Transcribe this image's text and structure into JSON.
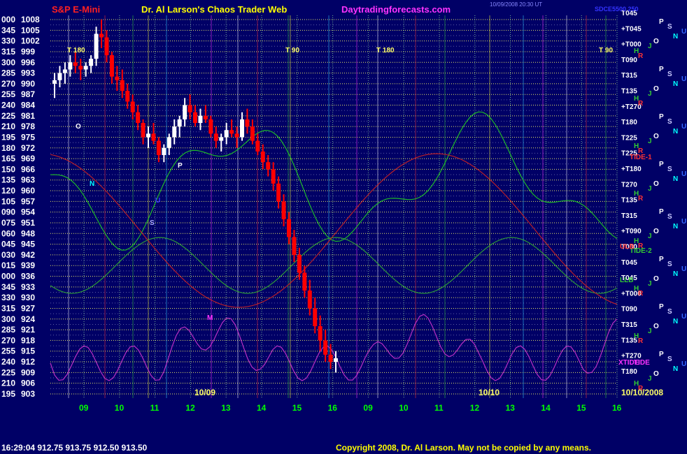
{
  "header": {
    "title_left": "S&P E-Mini",
    "title_center": "Dr. Al Larson's Chaos Trader Web",
    "title_right": "Daytradingforecasts.com",
    "timestamp": "10/09/2008 20:30 UT",
    "tag_right": "SDCE5500 250"
  },
  "footer": {
    "quote": "16:29:04  912.75 913.75 912.50 913.50",
    "copyright": "Copyright 2008, Dr. Al Larson. May not be copied by any means."
  },
  "chart_data": {
    "type": "candlestick",
    "ylim": [
      903,
      1008
    ],
    "y_ticks": [
      {
        "angle": "000",
        "price": "1008"
      },
      {
        "angle": "345",
        "price": "1005"
      },
      {
        "angle": "330",
        "price": "1002"
      },
      {
        "angle": "315",
        "price": "999"
      },
      {
        "angle": "300",
        "price": "996"
      },
      {
        "angle": "285",
        "price": "993"
      },
      {
        "angle": "270",
        "price": "990"
      },
      {
        "angle": "255",
        "price": "987"
      },
      {
        "angle": "240",
        "price": "984"
      },
      {
        "angle": "225",
        "price": "981"
      },
      {
        "angle": "210",
        "price": "978"
      },
      {
        "angle": "195",
        "price": "975"
      },
      {
        "angle": "180",
        "price": "972"
      },
      {
        "angle": "165",
        "price": "969"
      },
      {
        "angle": "150",
        "price": "966"
      },
      {
        "angle": "135",
        "price": "963"
      },
      {
        "angle": "120",
        "price": "960"
      },
      {
        "angle": "105",
        "price": "957"
      },
      {
        "angle": "090",
        "price": "954"
      },
      {
        "angle": "075",
        "price": "951"
      },
      {
        "angle": "060",
        "price": "948"
      },
      {
        "angle": "045",
        "price": "945"
      },
      {
        "angle": "030",
        "price": "942"
      },
      {
        "angle": "015",
        "price": "939"
      },
      {
        "angle": "000",
        "price": "936"
      },
      {
        "angle": "345",
        "price": "933"
      },
      {
        "angle": "330",
        "price": "930"
      },
      {
        "angle": "315",
        "price": "927"
      },
      {
        "angle": "300",
        "price": "924"
      },
      {
        "angle": "285",
        "price": "921"
      },
      {
        "angle": "270",
        "price": "918"
      },
      {
        "angle": "255",
        "price": "915"
      },
      {
        "angle": "240",
        "price": "912"
      },
      {
        "angle": "225",
        "price": "909"
      },
      {
        "angle": "210",
        "price": "906"
      },
      {
        "angle": "195",
        "price": "903"
      }
    ],
    "x_ticks": [
      "09",
      "10",
      "11",
      "12",
      "13",
      "14",
      "15",
      "16",
      "09",
      "10",
      "11",
      "12",
      "13",
      "14",
      "15",
      "16"
    ],
    "date_labels": [
      "10/09",
      "10/10",
      "10/10/2008"
    ],
    "right_labels": [
      "T045",
      "+T045",
      "+T000",
      "T090",
      "T315",
      "T135",
      "+T270",
      "T180",
      "T225",
      "T225",
      "+T180",
      "T270",
      "T135",
      "T315",
      "+T090",
      "T000",
      "T045",
      "T045",
      "+T000",
      "T090",
      "T315",
      "T135",
      "+T270",
      "T180"
    ],
    "right_letters": [
      "P",
      "S",
      "U",
      "N",
      "O",
      "J",
      "H",
      "R"
    ],
    "annotations": [
      "T 180",
      "T 90",
      "T 180",
      "T 90",
      "O",
      "P",
      "M",
      "S",
      "U",
      "N",
      "TIDE-1",
      "TIDE-2",
      "ULB",
      "LLB",
      "XTIDE",
      "TIDE"
    ],
    "colors": {
      "background": "#000066",
      "price_labels": "#FFFFFF",
      "time_labels": "#00FF00",
      "title_left": "#FF2020",
      "title_center": "#FFFF00",
      "title_right": "#FF33FF",
      "up_bar": "#FFFFFF",
      "down_bar": "#FF0000",
      "gridline": "#FFFF66",
      "flux_green": "#22CC22",
      "flux_magenta": "#CC33CC",
      "flux_red": "#CC2222"
    },
    "ohlc": [
      [
        990,
        993,
        986,
        991
      ],
      [
        991,
        995,
        989,
        993
      ],
      [
        993,
        996,
        990,
        994
      ],
      [
        994,
        998,
        992,
        996
      ],
      [
        996,
        999,
        993,
        995
      ],
      [
        995,
        997,
        991,
        994
      ],
      [
        994,
        996,
        992,
        995
      ],
      [
        995,
        998,
        993,
        997
      ],
      [
        997,
        1006,
        995,
        1004
      ],
      [
        1004,
        1008,
        1000,
        1003
      ],
      [
        1003,
        1005,
        996,
        998
      ],
      [
        998,
        999,
        990,
        992
      ],
      [
        992,
        995,
        988,
        991
      ],
      [
        991,
        994,
        986,
        988
      ],
      [
        988,
        990,
        983,
        985
      ],
      [
        985,
        987,
        980,
        982
      ],
      [
        982,
        984,
        977,
        979
      ],
      [
        979,
        980,
        973,
        975
      ],
      [
        975,
        978,
        972,
        976
      ],
      [
        976,
        979,
        973,
        974
      ],
      [
        974,
        975,
        968,
        970
      ],
      [
        970,
        973,
        968,
        972
      ],
      [
        972,
        976,
        970,
        975
      ],
      [
        975,
        980,
        973,
        978
      ],
      [
        978,
        981,
        975,
        980
      ],
      [
        980,
        986,
        978,
        984
      ],
      [
        984,
        987,
        980,
        982
      ],
      [
        982,
        984,
        978,
        979
      ],
      [
        979,
        983,
        977,
        981
      ],
      [
        981,
        984,
        979,
        980
      ],
      [
        980,
        981,
        975,
        976
      ],
      [
        976,
        978,
        972,
        974
      ],
      [
        974,
        976,
        971,
        975
      ],
      [
        975,
        979,
        973,
        977
      ],
      [
        977,
        980,
        975,
        976
      ],
      [
        976,
        978,
        972,
        975
      ],
      [
        975,
        982,
        974,
        980
      ],
      [
        980,
        983,
        976,
        978
      ],
      [
        978,
        980,
        973,
        974
      ],
      [
        974,
        976,
        970,
        971
      ],
      [
        971,
        973,
        966,
        968
      ],
      [
        968,
        970,
        964,
        966
      ],
      [
        966,
        968,
        960,
        962
      ],
      [
        962,
        964,
        955,
        957
      ],
      [
        957,
        959,
        950,
        952
      ],
      [
        952,
        954,
        945,
        947
      ],
      [
        947,
        949,
        940,
        942
      ],
      [
        942,
        944,
        935,
        937
      ],
      [
        937,
        939,
        930,
        932
      ],
      [
        932,
        935,
        925,
        927
      ],
      [
        927,
        930,
        920,
        922
      ],
      [
        922,
        925,
        915,
        918
      ],
      [
        918,
        921,
        912,
        914
      ],
      [
        914,
        917,
        910,
        912
      ],
      [
        912,
        915,
        909,
        913
      ]
    ]
  }
}
